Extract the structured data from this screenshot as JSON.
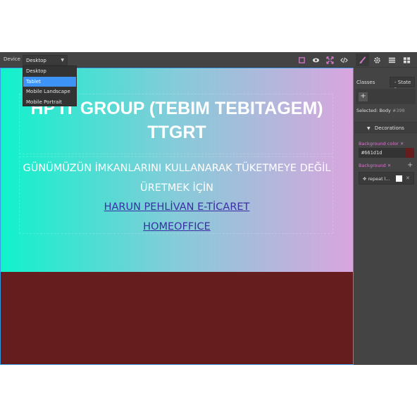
{
  "toolbar": {
    "device_label": "Device",
    "device_value": "Desktop",
    "device_options": [
      "Desktop",
      "Tablet",
      "Mobile Landscape",
      "Mobile Portrait"
    ],
    "device_highlighted": "Tablet",
    "tools": [
      "square-outline-icon",
      "eye-icon",
      "fullscreen-icon",
      "code-icon",
      "brush-icon",
      "gear-icon",
      "layers-icon",
      "blocks-icon"
    ],
    "accent_color": "#d278c9"
  },
  "canvas": {
    "background_color": "#661d1d",
    "gradient": [
      "#10f2cc",
      "#86cbd9",
      "#d9a5de"
    ],
    "hero_title": "HP IT GROUP (TEBIM TEBITAGEM) TTGRT",
    "hero_subtitle": "GÜNÜMÜZÜN İMKANLARINI KULLANARAK TÜKETMEYE DEĞİL ÜRETMEK İÇİN",
    "links": [
      "HARUN PEHLİVAN E-TİCARET",
      "HOMEOFFICE"
    ]
  },
  "panel": {
    "classes_label": "Classes",
    "state_label": "- State -",
    "add_label": "+",
    "selected_label": "Selected:",
    "selected_value": "Body",
    "selected_id": "#398",
    "decorations_label": "Decorations",
    "bg_color_label": "Background color",
    "bg_color_value": "#661d1d",
    "background_label": "Background",
    "bg_layer_label": "repeat l..."
  }
}
